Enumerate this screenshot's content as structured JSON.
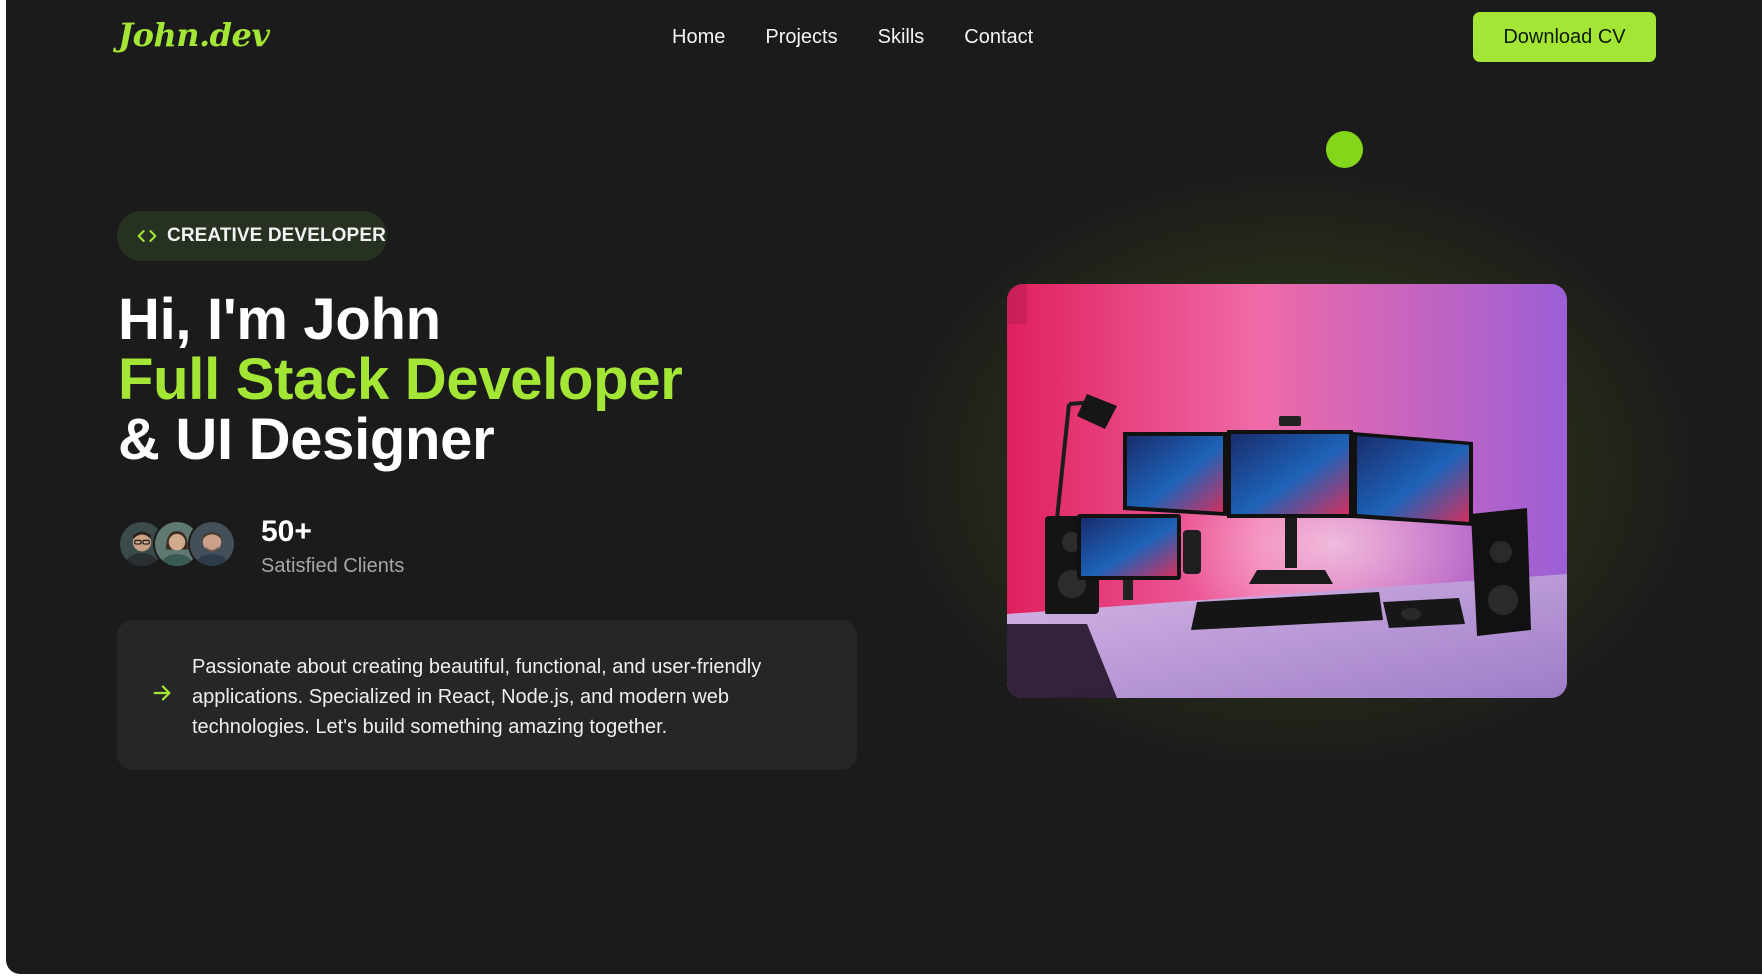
{
  "header": {
    "logo": "John.dev",
    "nav": [
      "Home",
      "Projects",
      "Skills",
      "Contact"
    ],
    "cta_label": "Download CV"
  },
  "hero": {
    "badge": "CREATIVE DEVELOPER",
    "badge_icon": "code-brackets-icon",
    "headline": {
      "line1": "Hi, I'm John",
      "line2": "Full Stack Developer",
      "line3": "& UI Designer"
    },
    "clients": {
      "count": "50+",
      "label": "Satisfied Clients"
    },
    "intro": "Passionate about creating beautiful, functional, and user-friendly applications. Specialized in React, Node.js, and modern web technologies. Let's build something amazing together.",
    "intro_icon": "arrow-right-icon",
    "image_alt": "workspace-desk-image"
  },
  "colors": {
    "accent": "#a3e635",
    "background": "#1b1b1b",
    "card": "#262626",
    "badge_bg": "#263122"
  }
}
